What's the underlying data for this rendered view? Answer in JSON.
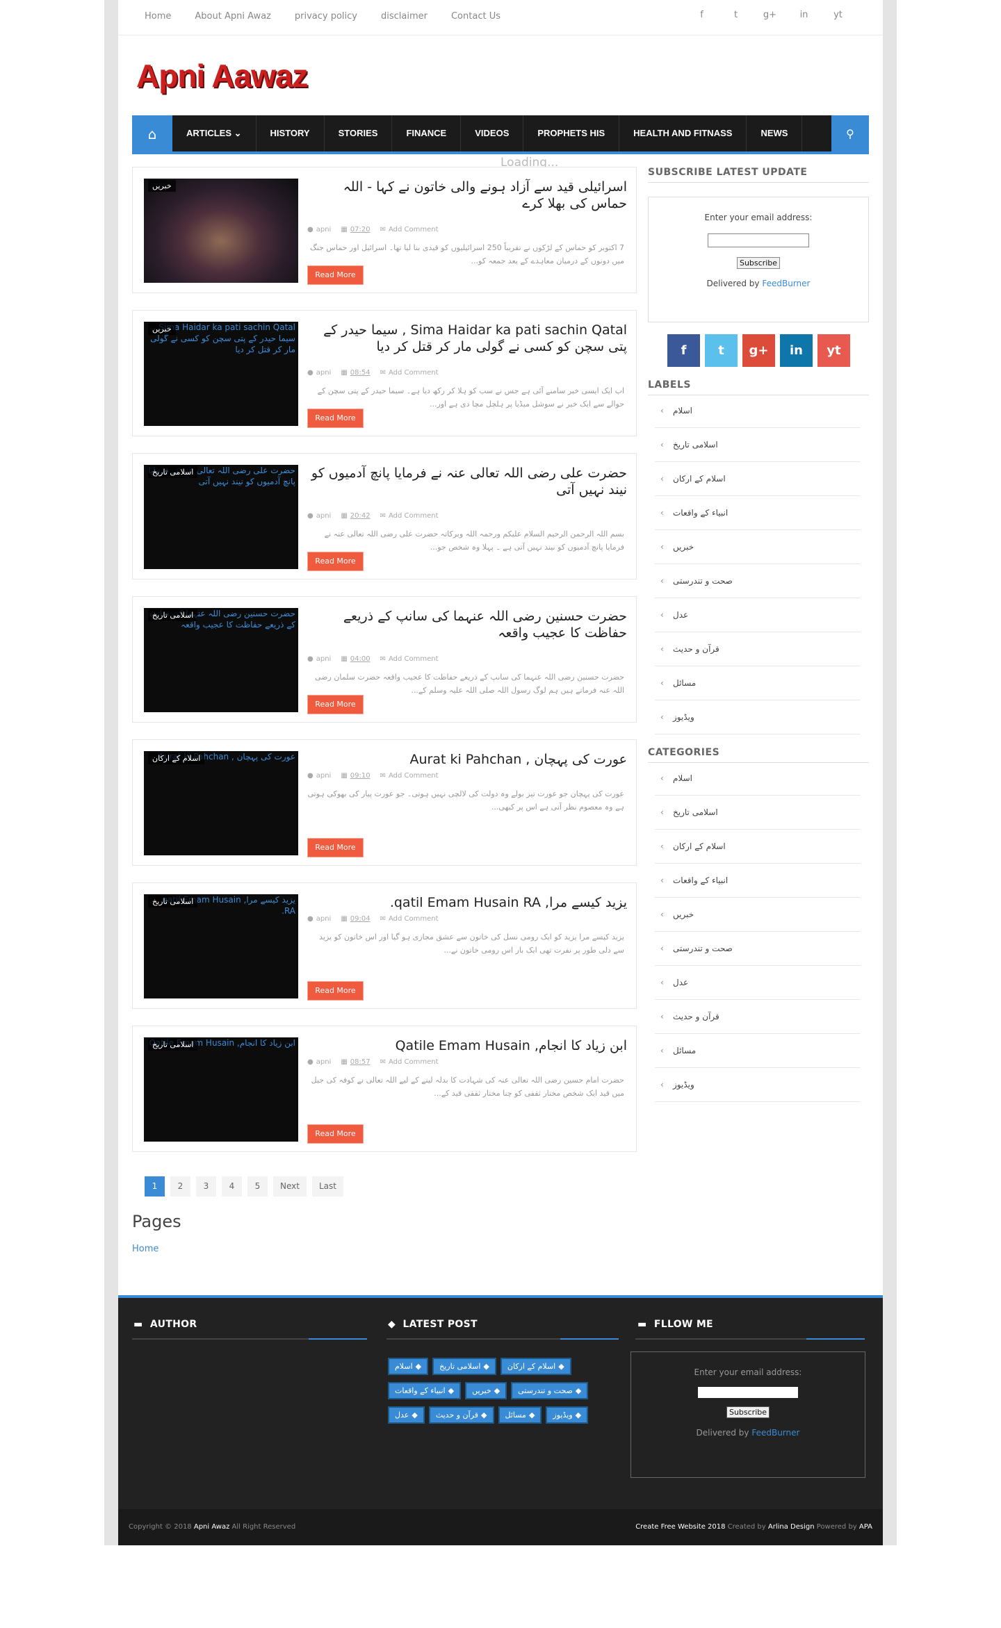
{
  "toplinks": [
    "Home",
    "About Apni Awaz",
    "privacy policy",
    "disclaimer",
    "Contact Us"
  ],
  "topsocial": [
    "f",
    "t",
    "g+",
    "in",
    "yt"
  ],
  "logo": "Apni Aawaz",
  "nav": {
    "items": [
      "ARTICLES",
      "HISTORY",
      "STORIES",
      "FINANCE",
      "VIDEOS",
      "PROPHETS HIS",
      "HEALTH AND FITNASS",
      "NEWS"
    ],
    "loading": "Loading..."
  },
  "posts": [
    {
      "tag": "خبریں",
      "title": "اسرائیلی قید سے آزاد ہونے والی خاتون نے کہا - اللہ حماس کی بھلا کرے",
      "author": "apni",
      "time": "07:20",
      "comments": "Add Comment",
      "excerpt": "7 اکتوبر کو حماس کے لڑکوں نے تقریباً 250 اسرائیلیوں کو قیدی بنا لیا تھا۔ اسرائیل اور حماس جنگ میں دونوں کے درمیان معاہدے کے بعد جمعہ کو...",
      "read": "Read More",
      "alt": ""
    },
    {
      "tag": "خبریں",
      "title": "Sima Haidar ka pati sachin Qatal , سیما حیدر کے پتی سچن کو کسی نے گولی مار کر قتل کر دیا",
      "author": "apni",
      "time": "08:54",
      "comments": "Add Comment",
      "excerpt": "اب ایک ایسی خبر سامنے آئی ہے جس نے سب کو ہلا کر رکھ دیا ہے۔ سیما حیدر کے پتی سچن کے حوالے سے ایک خبر نے سوشل میڈیا پر ہلچل مچا دی ہے اور...",
      "read": "Read More",
      "alt": "Sima Haidar ka pati sachin Qatal , سیما حیدر کے پتی سچن کو کسی نے گولی مار کر قتل کر دیا"
    },
    {
      "tag": "اسلامی تاریخ",
      "title": "حضرت علی رضی اللہ تعالی عنہ نے فرمایا پانچ آدمیوں کو نیند نہیں آتی",
      "author": "apni",
      "time": "20:42",
      "comments": "Add Comment",
      "excerpt": "بسم اللہ الرحمن الرحیم السلام علیکم ورحمہ اللہ وبرکاتہ حضرت علی رضی اللہ تعالی عنہ نے فرمایا پانچ آدمیوں کو نیند نہیں آتی ہے ۔ پہلا وہ شخص جو...",
      "read": "Read More",
      "alt": "حضرت علی رضی اللہ تعالی عنہ نے فرمایا پانچ آدمیوں کو نیند نہیں آتی"
    },
    {
      "tag": "اسلامی تاریخ",
      "title": "حضرت حسنین رضی اللہ عنہما کی سانپ کے ذریعے حفاظت کا عجیب واقعہ",
      "author": "apni",
      "time": "04:00",
      "comments": "Add Comment",
      "excerpt": "حضرت حسنین رضی اللہ عنہما کی سانپ کے ذریعے حفاظت کا عجیب واقعہ حضرت سلمان رضی اللہ عنہ فرماتے ہیں ہم لوگ رسول اللہ صلی اللہ علیہ وسلم کے...",
      "read": "Read More",
      "alt": "حضرت حسنین رضی اللہ عنہما کی سانپ کے ذریعے حفاظت کا عجیب واقعہ"
    },
    {
      "tag": "اسلام کے ارکان",
      "title": "عورت کی پہچان , Aurat ki Pahchan",
      "author": "apni",
      "time": "09:10",
      "comments": "Add Comment",
      "excerpt": "عورت کی پہچان جو عورت تیز بولے وہ دولت کی لالچی نہیں ہوتی۔ جو عورت پیار کی بھوکی ہوتی ہے وہ معصوم نظر آتی ہے اس پر کبھی...",
      "read": "Read More",
      "alt": "عورت کی پہچان , Aurat ki Pahchan"
    },
    {
      "tag": "اسلامی تاریخ",
      "title": "یزید کیسے مرا, qatil Emam Husain RA.",
      "author": "apni",
      "time": "09:04",
      "comments": "Add Comment",
      "excerpt": "یزید کیسے مرا یزید کو ایک رومی نسل کی خاتون سے عشق مجازی ہو گیا اور اس خاتون کو یزید سے دلی طور پر نفرت تھی ایک بار اس رومی خاتون نے...",
      "read": "Read More",
      "alt": "یزید کیسے مرا, qatil Emam Husain RA."
    },
    {
      "tag": "اسلامی تاریخ",
      "title": "ابن زیاد کا انجام, Qatile Emam Husain",
      "author": "apni",
      "time": "08:57",
      "comments": "Add Comment",
      "excerpt": "حضرت امام حسین رضی اللہ تعالی عنہ کی شہادت کا بدلہ لینے کے لیے اللہ تعالی نے کوفہ کی جیل میں قید ایک شخص مختار ثقفی کو چنا مختار ثقفی قید کے...",
      "read": "Read More",
      "alt": "ابن زیاد کا انجام, Qatile Emam Husain"
    }
  ],
  "pager": [
    "1",
    "2",
    "3",
    "4",
    "5",
    "Next",
    "Last"
  ],
  "pages": {
    "heading": "Pages",
    "home": "Home"
  },
  "sidebar": {
    "subscribe_heading": "SUBSCRIBE LATEST UPDATE",
    "email_label": "Enter your email address:",
    "subscribe_btn": "Subscribe",
    "delivered": "Delivered by",
    "feedburner": "FeedBurner",
    "social": [
      "f",
      "t",
      "g+",
      "in",
      "yt"
    ],
    "labels_heading": "LABELS",
    "labels": [
      "اسلام",
      "اسلامی تاریخ",
      "اسلام کے ارکان",
      "انبیاء کے واقعات",
      "خبریں",
      "صحت و تندرستی",
      "عدل",
      "قرآن و حدیث",
      "مسائل",
      "ویڈیوز"
    ],
    "categories_heading": "CATEGORIES",
    "categories": [
      "اسلام",
      "اسلامی تاریخ",
      "اسلام کے ارکان",
      "انبیاء کے واقعات",
      "خبریں",
      "صحت و تندرستی",
      "عدل",
      "قرآن و حدیث",
      "مسائل",
      "ویڈیوز"
    ]
  },
  "footer": {
    "author_h": "AUTHOR",
    "latest_h": "LATEST POST",
    "follow_h": "FLLOW ME",
    "tags": [
      "اسلام",
      "اسلامی تاریخ",
      "اسلام کے ارکان",
      "انبیاء کے واقعات",
      "خبریں",
      "صحت و تندرستی",
      "عدل",
      "قرآن و حدیث",
      "مسائل",
      "ویڈیوز"
    ],
    "email_label": "Enter your email address:",
    "subscribe_btn": "Subscribe",
    "delivered": "Delivered by",
    "feedburner": "FeedBurner",
    "copy_pre": "Copyright © 2018",
    "copy_site": "Apni Awaz",
    "copy_post": "All Right Reserved",
    "create": "Create Free Website 2018",
    "created_by": "Created by",
    "design": "Arlina Design",
    "powered_by": "Powered by",
    "apa": "APA"
  },
  "colors": {
    "accent": "#3a8bd5",
    "read_more": "#f05a3e",
    "nav_bg": "#1b1b1b",
    "logo": "#cc1f1f"
  }
}
